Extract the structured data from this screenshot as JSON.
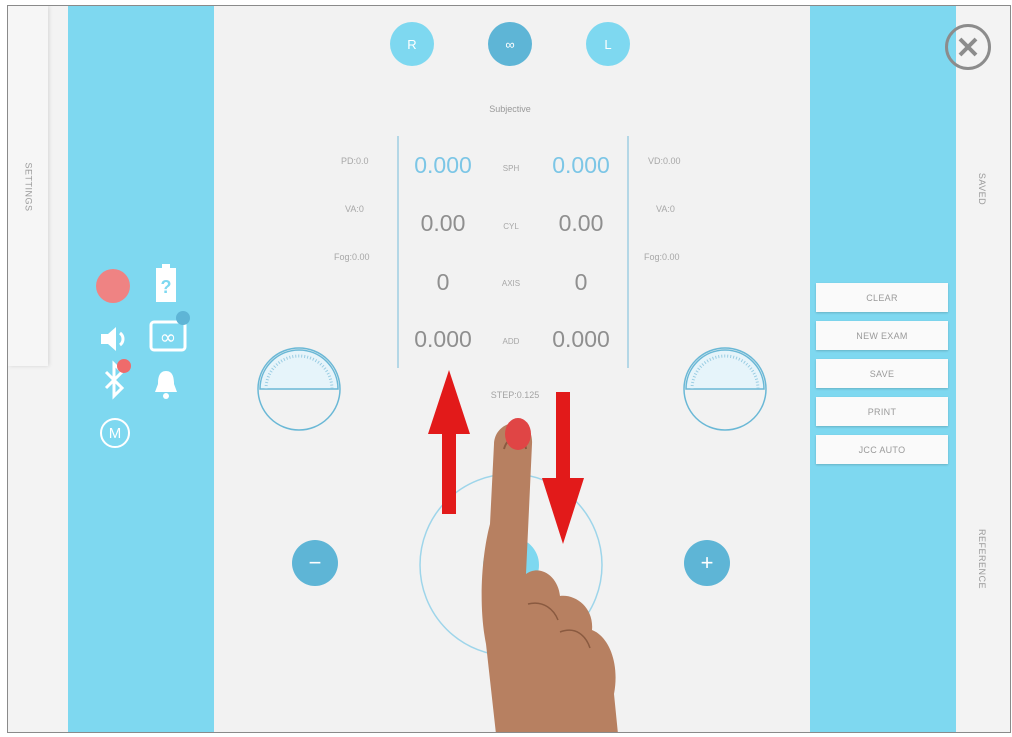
{
  "sidebar": {
    "settings_label": "SETTINGS",
    "saved_label": "SAVED",
    "reference_label": "REFERENCE"
  },
  "eye_selector": {
    "right": "R",
    "both": "∞",
    "left": "L"
  },
  "exam": {
    "mode": "Subjective",
    "left_info": {
      "pd": "PD:0.0",
      "va": "VA:0",
      "fog": "Fog:0.00"
    },
    "right_info": {
      "vd": "VD:0.00",
      "va": "VA:0",
      "fog": "Fog:0.00"
    },
    "rows": [
      {
        "label": "SPH",
        "right": "0.000",
        "left": "0.000"
      },
      {
        "label": "CYL",
        "right": "0.00",
        "left": "0.00"
      },
      {
        "label": "AXIS",
        "right": "0",
        "left": "0"
      },
      {
        "label": "ADD",
        "right": "0.000",
        "left": "0.000"
      }
    ],
    "step": "STEP:0.125"
  },
  "actions": [
    "CLEAR",
    "NEW EXAM",
    "SAVE",
    "PRINT",
    "JCC AUTO"
  ],
  "controls": {
    "minus": "−",
    "plus": "+"
  },
  "status_icons": {
    "mode_letter": "M"
  },
  "colors": {
    "panel": "#7ed8f0",
    "accent": "#5eb5d6",
    "value_blue": "#7cc6e6",
    "arrow": "#e21a1a"
  }
}
